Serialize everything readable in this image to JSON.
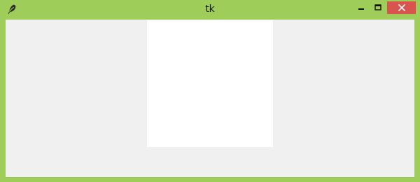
{
  "window": {
    "title": "tk",
    "frame_color": "#9fcd5a",
    "client_bg": "#f0f0f0",
    "canvas_bg": "#ffffff",
    "close_button_color": "#d9534f"
  },
  "icons": {
    "app": "feather-icon",
    "minimize": "minimize-icon",
    "maximize": "maximize-icon",
    "close": "close-icon"
  }
}
